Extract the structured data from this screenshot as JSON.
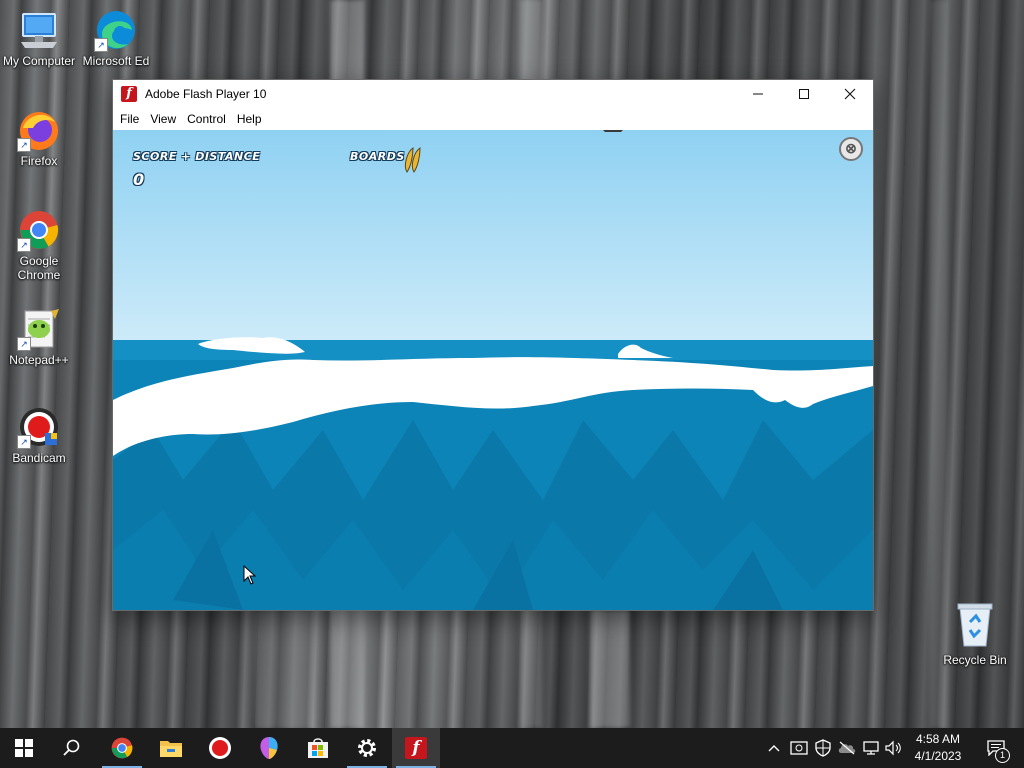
{
  "desktop": {
    "icons": [
      {
        "label": "My Computer"
      },
      {
        "label": "Microsoft Ed"
      },
      {
        "label": "Firefox"
      },
      {
        "label": "Google Chrome"
      },
      {
        "label": "Notepad++"
      },
      {
        "label": "Bandicam"
      },
      {
        "label": "Recycle Bin"
      }
    ]
  },
  "window": {
    "title": "Adobe Flash Player 10",
    "menu": [
      "File",
      "View",
      "Control",
      "Help"
    ],
    "controls": {
      "minimize": "—",
      "maximize": "☐",
      "close": "✕"
    }
  },
  "game": {
    "score_label": "SCORE + DISTANCE",
    "score_value": "0",
    "boards_label": "BOARDS",
    "boards_count": 2,
    "close_glyph": "⊗",
    "colors": {
      "sky_top": "#8fd1f2",
      "sky_bottom": "#cdebf9",
      "sea": "#0d84b7",
      "foam": "#ffffff"
    }
  },
  "taskbar": {
    "apps": [
      "start-button",
      "search-button",
      "chrome",
      "file-explorer",
      "bandicam",
      "paint-3d",
      "microsoft-store",
      "settings",
      "flash-player"
    ],
    "clock": {
      "time": "4:58 AM",
      "date": "4/1/2023"
    },
    "notification_count": "1"
  }
}
